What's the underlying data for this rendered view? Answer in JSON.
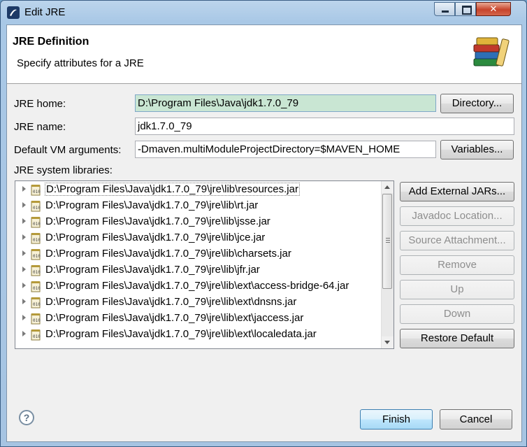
{
  "window": {
    "title": "Edit JRE",
    "minimize_icon": "minimize-icon",
    "maximize_icon": "maximize-icon",
    "close_icon": "close-icon"
  },
  "banner": {
    "title": "JRE Definition",
    "description": "Specify attributes for a JRE",
    "icon": "library-books-icon"
  },
  "form": {
    "jre_home_label": "JRE home:",
    "jre_home_value": "D:\\Program Files\\Java\\jdk1.7.0_79",
    "directory_button": "Directory...",
    "jre_name_label": "JRE name:",
    "jre_name_value": "jdk1.7.0_79",
    "vm_args_label": "Default VM arguments:",
    "vm_args_value": "-Dmaven.multiModuleProjectDirectory=$MAVEN_HOME",
    "variables_button": "Variables...",
    "libraries_label": "JRE system libraries:"
  },
  "libraries": [
    "D:\\Program Files\\Java\\jdk1.7.0_79\\jre\\lib\\resources.jar",
    "D:\\Program Files\\Java\\jdk1.7.0_79\\jre\\lib\\rt.jar",
    "D:\\Program Files\\Java\\jdk1.7.0_79\\jre\\lib\\jsse.jar",
    "D:\\Program Files\\Java\\jdk1.7.0_79\\jre\\lib\\jce.jar",
    "D:\\Program Files\\Java\\jdk1.7.0_79\\jre\\lib\\charsets.jar",
    "D:\\Program Files\\Java\\jdk1.7.0_79\\jre\\lib\\jfr.jar",
    "D:\\Program Files\\Java\\jdk1.7.0_79\\jre\\lib\\ext\\access-bridge-64.jar",
    "D:\\Program Files\\Java\\jdk1.7.0_79\\jre\\lib\\ext\\dnsns.jar",
    "D:\\Program Files\\Java\\jdk1.7.0_79\\jre\\lib\\ext\\jaccess.jar",
    "D:\\Program Files\\Java\\jdk1.7.0_79\\jre\\lib\\ext\\localedata.jar"
  ],
  "side_buttons": {
    "add_external": "Add External JARs...",
    "javadoc": "Javadoc Location...",
    "source": "Source Attachment...",
    "remove": "Remove",
    "up": "Up",
    "down": "Down",
    "restore": "Restore Default"
  },
  "footer": {
    "help_icon": "help-icon",
    "finish": "Finish",
    "cancel": "Cancel"
  },
  "colors": {
    "selection": "#c9e6d3",
    "default_button": "#bee6fd",
    "close_button": "#c7442b"
  }
}
